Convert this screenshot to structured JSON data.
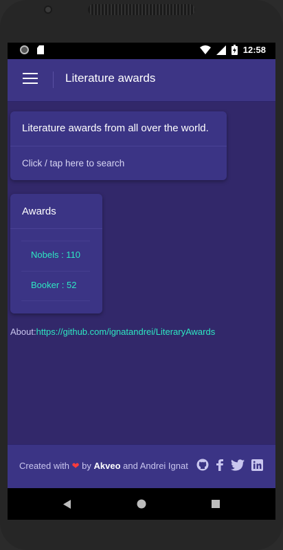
{
  "status_bar": {
    "time": "12:58"
  },
  "header": {
    "title": "Literature awards"
  },
  "search_card": {
    "title": "Literature awards from all over the world.",
    "link": "Click / tap here to search"
  },
  "awards_card": {
    "title": "Awards",
    "items": [
      {
        "label": "Nobels : 110"
      },
      {
        "label": "Booker : 52"
      }
    ]
  },
  "about": {
    "label": "About:",
    "link": "https://github.com/ignatandrei/LiteraryAwards"
  },
  "footer": {
    "created_with": "Created with",
    "by": "by",
    "akveo": "Akveo",
    "and": "and Andrei Ignat",
    "icons": [
      "github-icon",
      "facebook-icon",
      "twitter-icon",
      "linkedin-icon"
    ]
  },
  "colors": {
    "background": "#32286a",
    "header": "#3d3585",
    "card": "#3b3485",
    "accent": "#2ee8c3"
  }
}
